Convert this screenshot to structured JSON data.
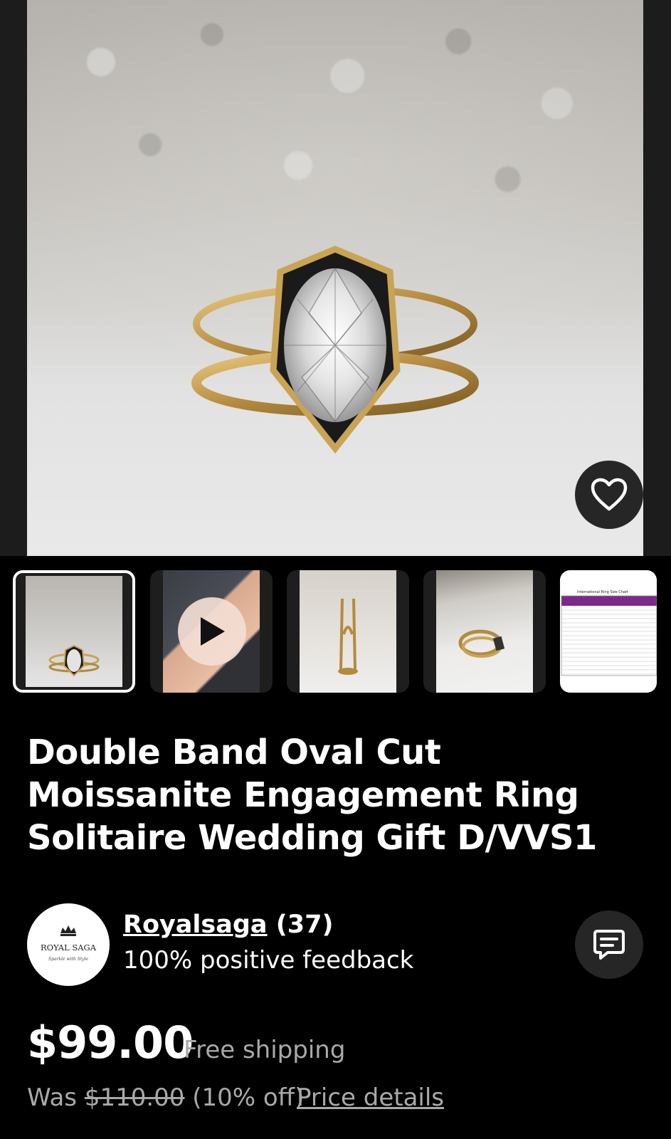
{
  "product": {
    "title": "Double Band Oval Cut Moissanite Engagement Ring Solitaire Wedding Gift D/VVS1",
    "thumbnails": [
      {
        "kind": "photo",
        "selected": true
      },
      {
        "kind": "video",
        "selected": false
      },
      {
        "kind": "photo",
        "selected": false
      },
      {
        "kind": "photo",
        "selected": false
      },
      {
        "kind": "size-chart",
        "selected": false
      }
    ],
    "size_chart_heading": "International Ring Size Chart"
  },
  "seller": {
    "name": "Royalsaga",
    "count": "(37)",
    "feedback": "100% positive feedback",
    "logo_text": "ROYAL SAGA",
    "logo_tagline": "Sparkle with Style"
  },
  "pricing": {
    "price": "$99.00",
    "shipping": "Free shipping",
    "was_label": "Was",
    "was_price": "$110.00",
    "discount": "(10% off)",
    "details_link": "Price details"
  },
  "icons": {
    "favorite": "heart-icon",
    "message": "chat-icon",
    "play": "play-icon"
  },
  "colors": {
    "background": "#000000",
    "button_bg": "#262626",
    "muted_text": "#a9a9a9",
    "play_bg": "#f3ddd4",
    "gold": "#c9a455"
  }
}
